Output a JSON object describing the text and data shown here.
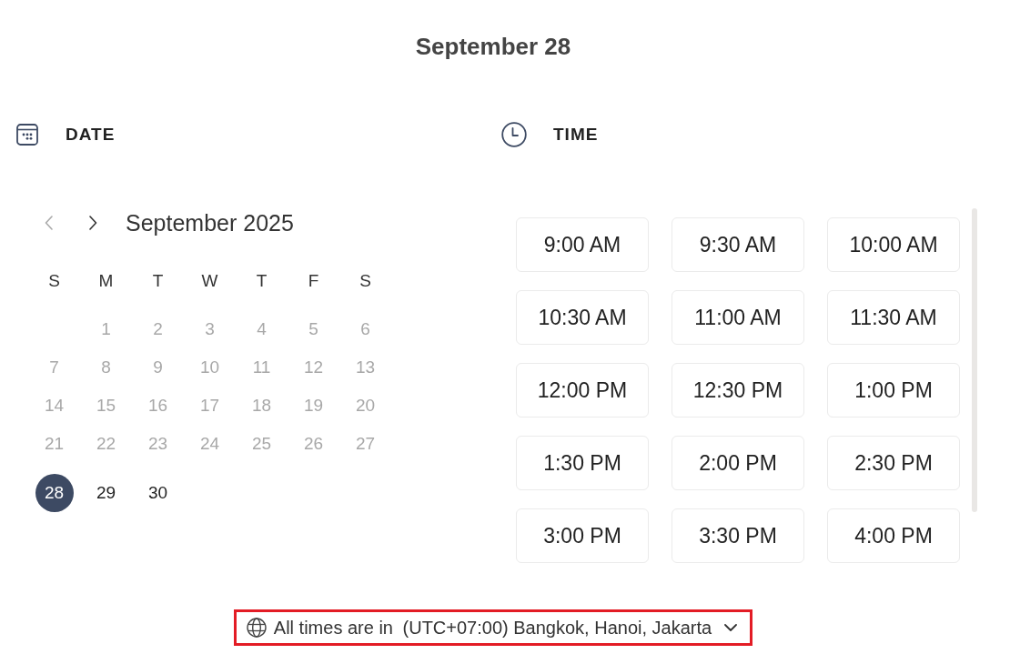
{
  "title": "September 28",
  "date": {
    "label": "DATE",
    "calendar": {
      "month": "September 2025",
      "prev": {
        "disabled": true
      },
      "next": {
        "disabled": false
      },
      "weekdays": [
        "S",
        "M",
        "T",
        "W",
        "T",
        "F",
        "S"
      ],
      "weeks": [
        [
          {
            "day": "1",
            "disabled": true,
            "selected": false
          },
          {
            "day": "2",
            "disabled": true,
            "selected": false
          },
          {
            "day": "3",
            "disabled": true,
            "selected": false
          },
          {
            "day": "4",
            "disabled": true,
            "selected": false
          },
          {
            "day": "5",
            "disabled": true,
            "selected": false
          },
          {
            "day": "6",
            "disabled": true,
            "selected": false
          }
        ],
        [
          {
            "day": "7",
            "disabled": true,
            "selected": false
          },
          {
            "day": "8",
            "disabled": true,
            "selected": false
          },
          {
            "day": "9",
            "disabled": true,
            "selected": false
          },
          {
            "day": "10",
            "disabled": true,
            "selected": false
          },
          {
            "day": "11",
            "disabled": true,
            "selected": false
          },
          {
            "day": "12",
            "disabled": true,
            "selected": false
          },
          {
            "day": "13",
            "disabled": true,
            "selected": false
          }
        ],
        [
          {
            "day": "14",
            "disabled": true,
            "selected": false
          },
          {
            "day": "15",
            "disabled": true,
            "selected": false
          },
          {
            "day": "16",
            "disabled": true,
            "selected": false
          },
          {
            "day": "17",
            "disabled": true,
            "selected": false
          },
          {
            "day": "18",
            "disabled": true,
            "selected": false
          },
          {
            "day": "19",
            "disabled": true,
            "selected": false
          },
          {
            "day": "20",
            "disabled": true,
            "selected": false
          }
        ],
        [
          {
            "day": "21",
            "disabled": true,
            "selected": false
          },
          {
            "day": "22",
            "disabled": true,
            "selected": false
          },
          {
            "day": "23",
            "disabled": true,
            "selected": false
          },
          {
            "day": "24",
            "disabled": true,
            "selected": false
          },
          {
            "day": "25",
            "disabled": true,
            "selected": false
          },
          {
            "day": "26",
            "disabled": true,
            "selected": false
          },
          {
            "day": "27",
            "disabled": true,
            "selected": false
          }
        ],
        [
          {
            "day": "28",
            "disabled": false,
            "selected": true
          },
          {
            "day": "29",
            "disabled": false,
            "selected": false
          },
          {
            "day": "30",
            "disabled": false,
            "selected": false
          }
        ]
      ]
    }
  },
  "time": {
    "label": "TIME",
    "slots": [
      {
        "label": "9:00 AM",
        "selected": false
      },
      {
        "label": "9:30 AM",
        "selected": false
      },
      {
        "label": "10:00 AM",
        "selected": false
      },
      {
        "label": "10:30 AM",
        "selected": false
      },
      {
        "label": "11:00 AM",
        "selected": false
      },
      {
        "label": "11:30 AM",
        "selected": false
      },
      {
        "label": "12:00 PM",
        "selected": false
      },
      {
        "label": "12:30 PM",
        "selected": false
      },
      {
        "label": "1:00 PM",
        "selected": false
      },
      {
        "label": "1:30 PM",
        "selected": false
      },
      {
        "label": "2:00 PM",
        "selected": false
      },
      {
        "label": "2:30 PM",
        "selected": false
      },
      {
        "label": "3:00 PM",
        "selected": false
      },
      {
        "label": "3:30 PM",
        "selected": false
      },
      {
        "label": "4:00 PM",
        "selected": false
      }
    ]
  },
  "timezone": {
    "label": "All times are in",
    "value": "(UTC+07:00) Bangkok, Hanoi, Jakarta",
    "highlighted": true
  }
}
